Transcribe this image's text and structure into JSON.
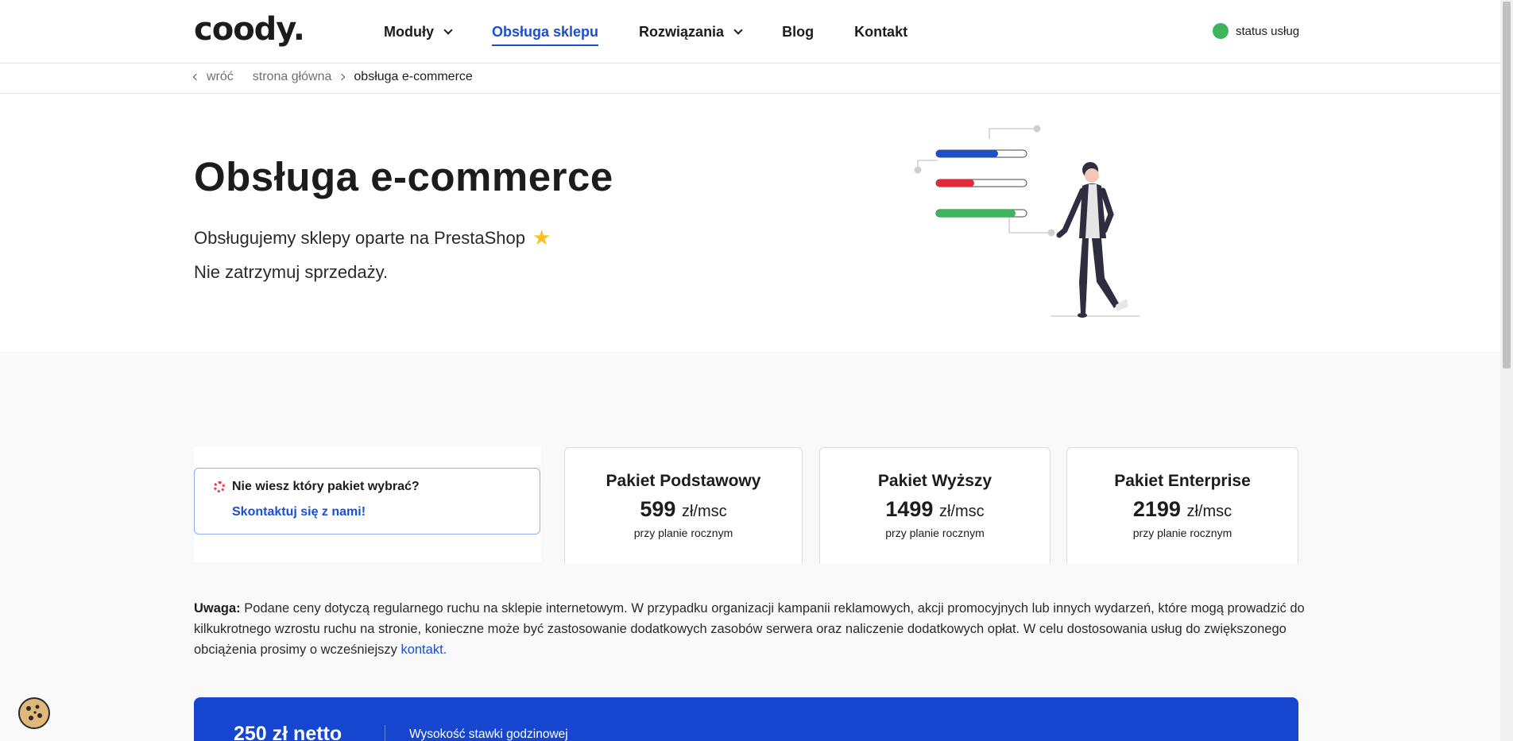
{
  "header": {
    "logo": "coody.",
    "nav": [
      {
        "label": "Moduły",
        "dropdown": true
      },
      {
        "label": "Obsługa sklepu",
        "active": true
      },
      {
        "label": "Rozwiązania",
        "dropdown": true
      },
      {
        "label": "Blog"
      },
      {
        "label": "Kontakt"
      }
    ],
    "status_label": "status usług",
    "status_color": "#3cb55d"
  },
  "breadcrumb": {
    "back": "wróć",
    "home": "strona główna",
    "current": "obsługa e-commerce"
  },
  "hero": {
    "title": "Obsługa e-commerce",
    "subtitle": "Obsługujemy sklepy oparte na PrestaShop",
    "subtitle_icon": "star-icon",
    "tagline": "Nie zatrzymuj sprzedaży.",
    "illustration_bar_fill": [
      0.68,
      0.42,
      0.88
    ],
    "illustration_colors": [
      "#1a4fd0",
      "#e02b3a",
      "#3cb55d"
    ]
  },
  "help": {
    "question": "Nie wiesz który pakiet wybrać?",
    "link": "Skontaktuj się z nami!"
  },
  "plans": [
    {
      "name": "Pakiet Podstawowy",
      "price": "599",
      "unit": "zł/msc",
      "note": "przy planie rocznym"
    },
    {
      "name": "Pakiet Wyższy",
      "price": "1499",
      "unit": "zł/msc",
      "note": "przy planie rocznym"
    },
    {
      "name": "Pakiet Enterprise",
      "price": "2199",
      "unit": "zł/msc",
      "note": "przy planie rocznym"
    }
  ],
  "notice": {
    "label": "Uwaga:",
    "text": "Podane ceny dotyczą regularnego ruchu na sklepie internetowym. W przypadku organizacji kampanii reklamowych, akcji promocyjnych lub innych wydarzeń, które mogą prowadzić do kilkukrotnego wzrostu ruchu na stronie, konieczne może być zastosowanie dodatkowych zasobów serwera oraz naliczenie dodatkowych opłat. W celu dostosowania usług do zwiększonego obciążenia prosimy o wcześniejszy",
    "link": "kontakt."
  },
  "rate": {
    "price": "250 zł netto",
    "label": "Wysokość stawki godzinowej"
  },
  "colors": {
    "accent": "#1a4fd0",
    "rate_bg": "#1645cf"
  }
}
